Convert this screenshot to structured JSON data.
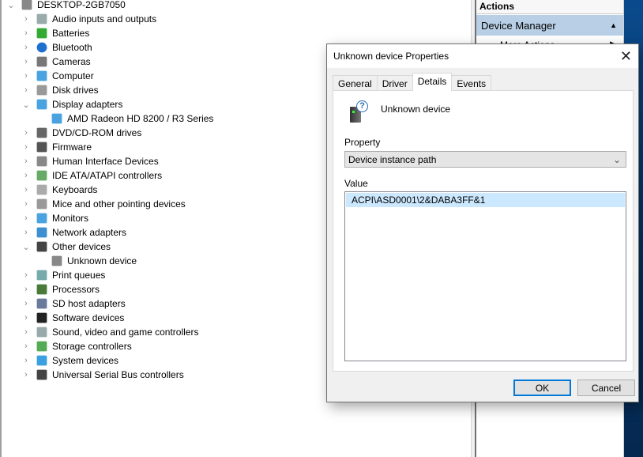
{
  "tree": {
    "root": "DESKTOP-2GB7050",
    "items": [
      {
        "label": "Audio inputs and outputs",
        "icon": "speaker-icon",
        "expanded": false
      },
      {
        "label": "Batteries",
        "icon": "battery-icon",
        "expanded": false
      },
      {
        "label": "Bluetooth",
        "icon": "bluetooth-icon",
        "expanded": false
      },
      {
        "label": "Cameras",
        "icon": "camera-icon",
        "expanded": false
      },
      {
        "label": "Computer",
        "icon": "monitor-icon",
        "expanded": false
      },
      {
        "label": "Disk drives",
        "icon": "disk-drive-icon",
        "expanded": false
      },
      {
        "label": "Display adapters",
        "icon": "display-adapter-icon",
        "expanded": true,
        "children": [
          "AMD Radeon HD 8200 / R3 Series"
        ]
      },
      {
        "label": "DVD/CD-ROM drives",
        "icon": "dvd-icon",
        "expanded": false
      },
      {
        "label": "Firmware",
        "icon": "firmware-icon",
        "expanded": false
      },
      {
        "label": "Human Interface Devices",
        "icon": "hid-icon",
        "expanded": false
      },
      {
        "label": "IDE ATA/ATAPI controllers",
        "icon": "ide-icon",
        "expanded": false
      },
      {
        "label": "Keyboards",
        "icon": "keyboard-icon",
        "expanded": false
      },
      {
        "label": "Mice and other pointing devices",
        "icon": "mouse-icon",
        "expanded": false
      },
      {
        "label": "Monitors",
        "icon": "monitor-icon",
        "expanded": false
      },
      {
        "label": "Network adapters",
        "icon": "network-icon",
        "expanded": false
      },
      {
        "label": "Other devices",
        "icon": "unknown-device-icon",
        "expanded": true,
        "children": [
          "Unknown device"
        ]
      },
      {
        "label": "Print queues",
        "icon": "printer-icon",
        "expanded": false
      },
      {
        "label": "Processors",
        "icon": "processor-icon",
        "expanded": false
      },
      {
        "label": "SD host adapters",
        "icon": "sd-icon",
        "expanded": false
      },
      {
        "label": "Software devices",
        "icon": "software-device-icon",
        "expanded": false
      },
      {
        "label": "Sound, video and game controllers",
        "icon": "speaker-icon",
        "expanded": false
      },
      {
        "label": "Storage controllers",
        "icon": "storage-icon",
        "expanded": false
      },
      {
        "label": "System devices",
        "icon": "system-icon",
        "expanded": false
      },
      {
        "label": "Universal Serial Bus controllers",
        "icon": "usb-icon",
        "expanded": false
      }
    ]
  },
  "actions": {
    "header": "Actions",
    "section": "Device Manager",
    "more": "More Actions"
  },
  "dialog": {
    "title": "Unknown device Properties",
    "tabs": [
      "General",
      "Driver",
      "Details",
      "Events"
    ],
    "selected_tab": "Details",
    "device_name": "Unknown device",
    "property_label": "Property",
    "property_value": "Device instance path",
    "value_label": "Value",
    "value": "ACPI\\ASD0001\\2&DABA3FF&1",
    "ok": "OK",
    "cancel": "Cancel"
  },
  "colors": {
    "selection": "#cce8ff",
    "accent": "#0078d7",
    "actions_section": "#b8cfe6"
  }
}
